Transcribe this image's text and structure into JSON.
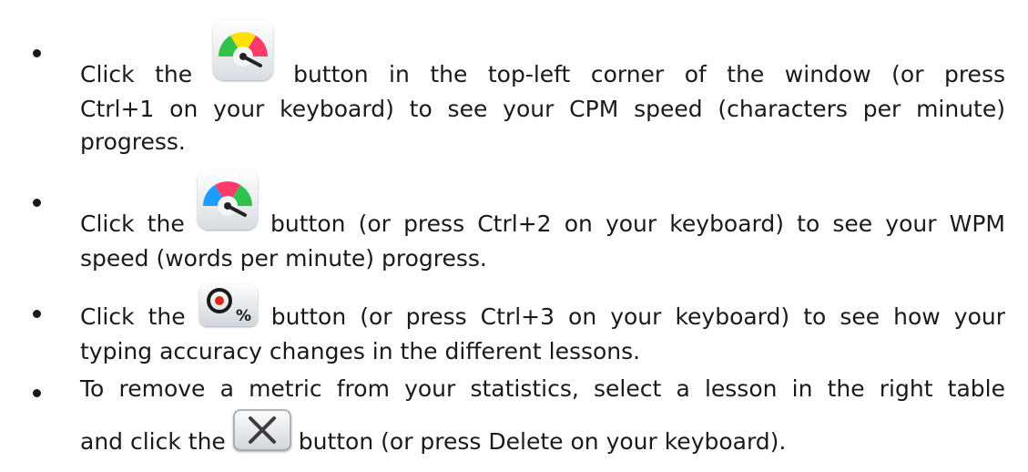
{
  "instructions": [
    {
      "icon": "cpm-speed-gauge-icon",
      "lines": [
        [
          "Click the",
          "button in the top-left corner of the window (or press"
        ],
        [
          "Ctrl+1 on your keyboard) to see your CPM speed (characters per minute)"
        ],
        [
          "progress."
        ]
      ]
    },
    {
      "icon": "wpm-speed-gauge-icon",
      "lines": [
        [
          "Click the",
          "button (or press Ctrl+2 on your keyboard) to see your WPM"
        ],
        [
          "speed (words per minute) progress."
        ]
      ]
    },
    {
      "icon": "accuracy-target-icon",
      "lines": [
        [
          "Click the",
          "button (or press Ctrl+3 on your keyboard) to see how your"
        ],
        [
          "typing accuracy changes in the different lessons."
        ]
      ]
    },
    {
      "icon": "delete-x-icon",
      "lines": [
        [
          "To remove a metric from your statistics, select a lesson in the right table"
        ],
        [
          "and click the",
          "button (or press Delete on your keyboard)."
        ]
      ]
    }
  ],
  "icon_glyphs": {
    "accuracy_percent": "%"
  },
  "colors": {
    "text": "#1a1a1a",
    "cpm_gauge": [
      "#ffe100",
      "#ff3b6b",
      "#30c24a"
    ],
    "wpm_gauge": [
      "#ff3b6b",
      "#1e9bff",
      "#2fc24a"
    ]
  }
}
